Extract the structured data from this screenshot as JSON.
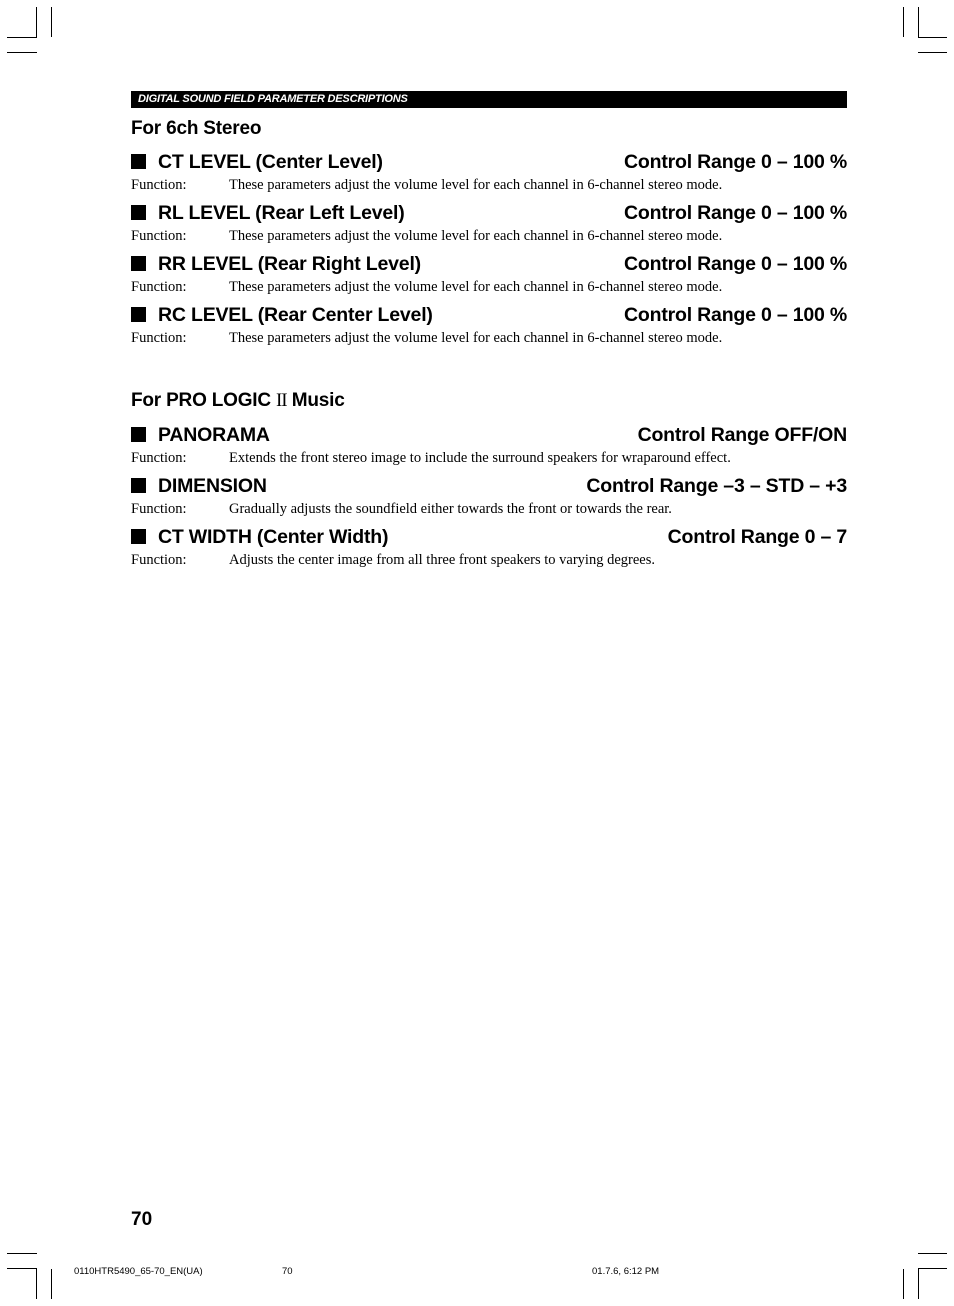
{
  "header": {
    "banner": "DIGITAL SOUND FIELD PARAMETER DESCRIPTIONS"
  },
  "sections": [
    {
      "title": "For 6ch Stereo",
      "params": [
        {
          "name": "CT LEVEL (Center Level)",
          "range": "Control Range 0 – 100 %",
          "function_label": "Function:",
          "function_text": "These parameters adjust the volume level for each channel in 6-channel stereo mode."
        },
        {
          "name": "RL LEVEL (Rear Left Level)",
          "range": "Control Range 0 – 100 %",
          "function_label": "Function:",
          "function_text": "These parameters adjust the volume level for each channel in 6-channel stereo mode."
        },
        {
          "name": "RR LEVEL (Rear Right Level)",
          "range": "Control Range 0 – 100 %",
          "function_label": "Function:",
          "function_text": "These parameters adjust the volume level for each channel in 6-channel stereo mode."
        },
        {
          "name": "RC LEVEL (Rear Center Level)",
          "range": "Control Range 0 – 100 %",
          "function_label": "Function:",
          "function_text": "These parameters adjust the volume level for each channel in 6-channel stereo mode."
        }
      ]
    },
    {
      "title_prefix": "For PRO LOGIC ",
      "title_glyph": "II",
      "title_suffix": " Music",
      "params": [
        {
          "name": "PANORAMA",
          "range": "Control Range OFF/ON",
          "function_label": "Function:",
          "function_text": "Extends the front stereo image to include the surround speakers for wraparound effect."
        },
        {
          "name": "DIMENSION",
          "range": "Control Range –3 – STD – +3",
          "function_label": "Function:",
          "function_text": "Gradually adjusts the soundfield either towards the front or towards the rear."
        },
        {
          "name": "CT WIDTH (Center Width)",
          "range": "Control Range 0 – 7",
          "function_label": "Function:",
          "function_text": "Adjusts the center image from all three front speakers to varying degrees."
        }
      ]
    }
  ],
  "footer": {
    "page_number": "70",
    "file_name": "0110HTR5490_65-70_EN(UA)",
    "file_page": "70",
    "timestamp": "01.7.6, 6:12 PM"
  }
}
